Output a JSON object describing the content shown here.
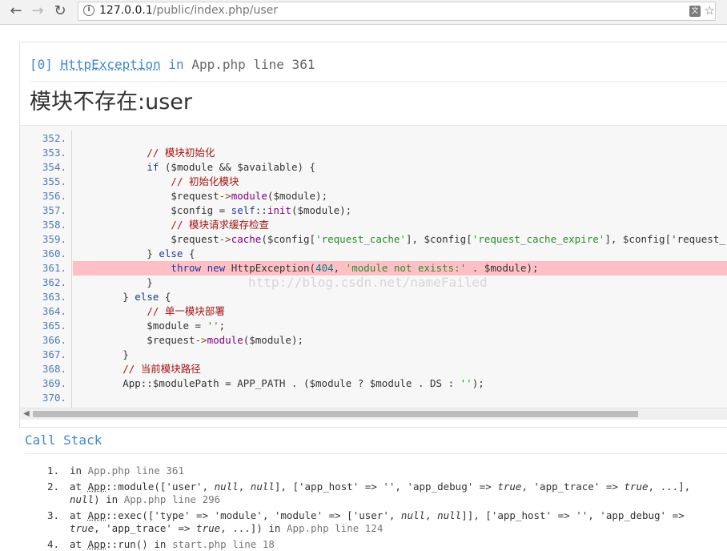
{
  "browser": {
    "url_host": "127.0.0.1",
    "url_path": "/public/index.php/user",
    "icons": [
      "back-arrow-icon",
      "forward-arrow-icon",
      "reload-icon",
      "info-icon",
      "translate-icon",
      "star-icon"
    ]
  },
  "exception": {
    "index": "[0]",
    "class_name": "HttpException",
    "in_word": "in",
    "location": "App.php line 361",
    "message": "模块不存在:user"
  },
  "code": {
    "highlight_line": "361.",
    "lines": [
      {
        "num": "352.",
        "text": ""
      },
      {
        "num": "353.",
        "text": "            // 模块初始化"
      },
      {
        "num": "354.",
        "text": "            if ($module && $available) {"
      },
      {
        "num": "355.",
        "text": "                // 初始化模块"
      },
      {
        "num": "356.",
        "text": "                $request->module($module);"
      },
      {
        "num": "357.",
        "text": "                $config = self::init($module);"
      },
      {
        "num": "358.",
        "text": "                // 模块请求缓存检查"
      },
      {
        "num": "359.",
        "text": "                $request->cache($config['request_cache'], $config['request_cache_expire'], $config['request_"
      },
      {
        "num": "360.",
        "text": "            } else {"
      },
      {
        "num": "361.",
        "text": "                throw new HttpException(404, 'module not exists:' . $module);"
      },
      {
        "num": "362.",
        "text": "            }"
      },
      {
        "num": "363.",
        "text": "        } else {"
      },
      {
        "num": "364.",
        "text": "            // 单一模块部署"
      },
      {
        "num": "365.",
        "text": "            $module = '';"
      },
      {
        "num": "366.",
        "text": "            $request->module($module);"
      },
      {
        "num": "367.",
        "text": "        }"
      },
      {
        "num": "368.",
        "text": "        // 当前模块路径"
      },
      {
        "num": "369.",
        "text": "        App::$modulePath = APP_PATH . ($module ? $module . DS : '');"
      },
      {
        "num": "370.",
        "text": ""
      }
    ]
  },
  "watermark": "http://blog.csdn.net/nameFailed",
  "call_stack": {
    "title": "Call Stack",
    "items": [
      {
        "num": "1.",
        "text": "in App.php line 361"
      },
      {
        "num": "2.",
        "text": "at App::module(['user', null, null], ['app_host' => '', 'app_debug' => true, 'app_trace' => true, ...], null) in App.php line 296"
      },
      {
        "num": "3.",
        "text": "at App::exec(['type' => 'module', 'module' => ['user', null, null]], ['app_host' => '', 'app_debug' => true, 'app_trace' => true, ...]) in App.php line 124"
      },
      {
        "num": "4.",
        "text": "at App::run() in start.php line 18"
      }
    ]
  }
}
